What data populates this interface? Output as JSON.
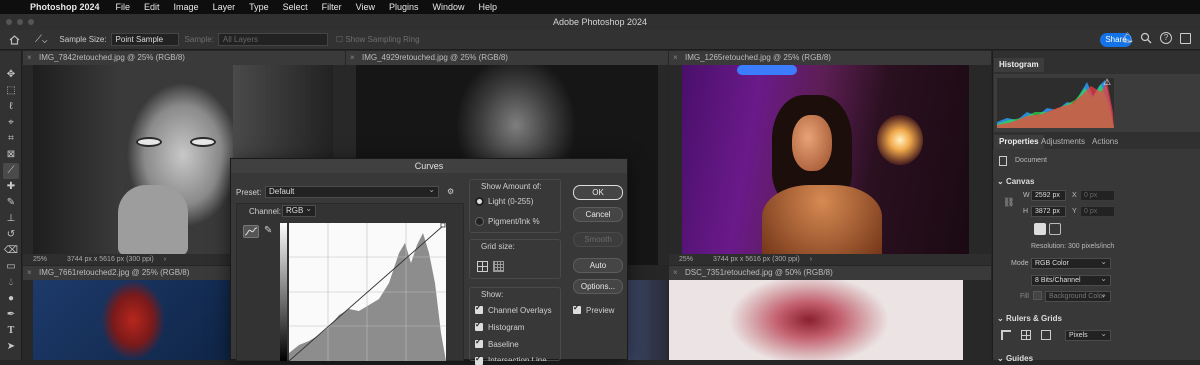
{
  "menubar": {
    "app": "Photoshop 2024",
    "items": [
      "File",
      "Edit",
      "Image",
      "Layer",
      "Type",
      "Select",
      "Filter",
      "View",
      "Plugins",
      "Window",
      "Help"
    ]
  },
  "window_title": "Adobe Photoshop 2024",
  "options": {
    "sample_size_label": "Sample Size:",
    "sample_size_value": "Point Sample",
    "sample_label": "Sample:",
    "sample_value": "All Layers",
    "show_ring": "Show Sampling Ring",
    "share": "Share"
  },
  "docs": [
    {
      "title": "IMG_7842retouched.jpg @ 25% (RGB/8)",
      "zoom": "25%",
      "info": "3744 px x 5616 px (300 ppi)"
    },
    {
      "title": "IMG_4929retouched.jpg @ 25% (RGB/8)"
    },
    {
      "title": "IMG_1265retouched.jpg @ 25% (RGB/8)",
      "zoom": "25%",
      "info": "3744 px x 5616 px (300 ppi)"
    },
    {
      "title": "IMG_7661retouched2.jpg @ 25% (RGB/8)"
    },
    {
      "title": "DSC_7351retouched.jpg @ 50% (RGB/8)"
    }
  ],
  "curves": {
    "title": "Curves",
    "preset_label": "Preset:",
    "preset_value": "Default",
    "channel_label": "Channel:",
    "channel_value": "RGB",
    "show_amount_title": "Show Amount of:",
    "light": "Light  (0-255)",
    "pigment": "Pigment/Ink %",
    "grid_size_title": "Grid size:",
    "show_title": "Show:",
    "channel_overlays": "Channel Overlays",
    "histogram": "Histogram",
    "baseline": "Baseline",
    "intersection_line": "Intersection Line",
    "buttons": {
      "ok": "OK",
      "cancel": "Cancel",
      "smooth": "Smooth",
      "auto": "Auto",
      "options": "Options..."
    },
    "preview": "Preview"
  },
  "panels": {
    "histogram_tab": "Histogram",
    "tabs": [
      "Properties",
      "Adjustments",
      "Actions"
    ],
    "document": "Document",
    "canvas": "Canvas",
    "w_label": "W",
    "w_value": "2592 px",
    "h_label": "H",
    "h_value": "3872 px",
    "x_label": "X",
    "x_value": "0 px",
    "y_label": "Y",
    "y_value": "0 px",
    "resolution": "Resolution: 300 pixels/inch",
    "mode_label": "Mode",
    "mode_value": "RGB Color",
    "bits_value": "8 Bits/Channel",
    "fill_label": "Fill",
    "fill_value": "Background Color",
    "rulers": "Rulers & Grids",
    "units_value": "Pixels",
    "guides": "Guides"
  }
}
